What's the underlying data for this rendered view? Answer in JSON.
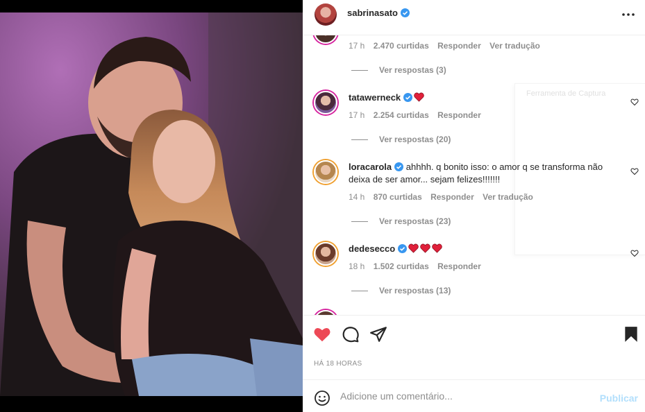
{
  "post": {
    "username": "sabrinasato",
    "more_icon": "more-horizontal-icon",
    "timestamp": "HÁ 18 HORAS"
  },
  "comments": [
    {
      "username": "",
      "text": "",
      "time": "17 h",
      "likes": "2.470 curtidas",
      "reply": "Responder",
      "translate": "Ver tradução",
      "view_replies": "Ver respostas (3)"
    },
    {
      "username": "tatawerneck",
      "text": "",
      "emojis": 1,
      "time": "17 h",
      "likes": "2.254 curtidas",
      "reply": "Responder",
      "view_replies": "Ver respostas (20)"
    },
    {
      "username": "loracarola",
      "text_line1": "ahhhh. q bonito isso: o amor q se transforma não",
      "text_line2": "deixa de ser amor... sejam felizes!!!!!!!",
      "time": "14 h",
      "likes": "870 curtidas",
      "reply": "Responder",
      "translate": "Ver tradução",
      "view_replies": "Ver respostas (23)"
    },
    {
      "username": "dedesecco",
      "emojis": 3,
      "time": "18 h",
      "likes": "1.502 curtidas",
      "reply": "Responder",
      "view_replies": "Ver respostas (13)"
    }
  ],
  "ghost_overlay_text": "Ferramenta de Captura",
  "composer": {
    "placeholder": "Adicione um comentário...",
    "publish_label": "Publicar"
  },
  "colors": {
    "like_red": "#ed4956",
    "verified_blue": "#3897f0",
    "publish_disabled": "#b2dffc",
    "muted_text": "#8e8e8e"
  }
}
